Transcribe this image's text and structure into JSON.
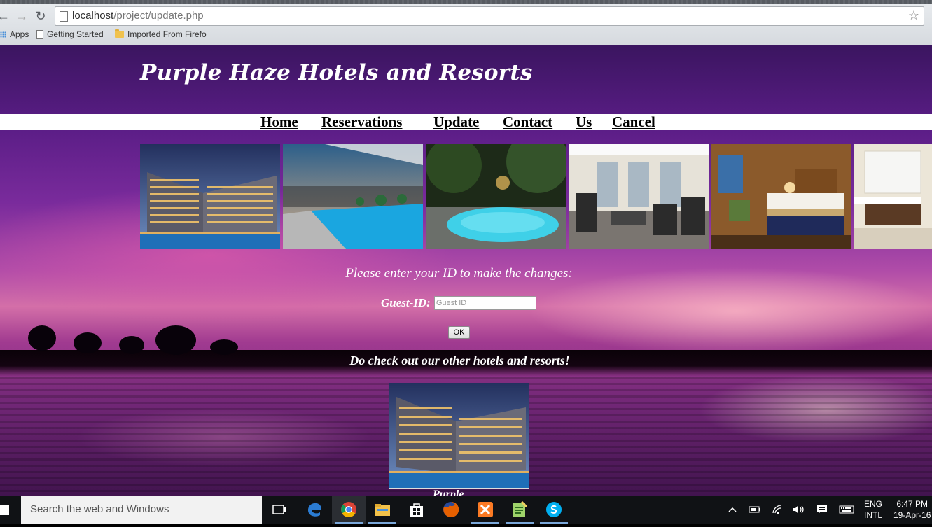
{
  "browser": {
    "url_host": "localhost",
    "url_path": "/project/update.php",
    "bookmarks": [
      {
        "label": "Apps",
        "icon": "apps-grid-icon"
      },
      {
        "label": "Getting Started",
        "icon": "page-icon"
      },
      {
        "label": "Imported From Firefo",
        "icon": "folder-icon"
      }
    ]
  },
  "site": {
    "title": "Purple Haze Hotels and Resorts",
    "nav": [
      "Home",
      "Reservations",
      "Update",
      "Contact",
      "Us",
      "Cancel"
    ],
    "gallery": [
      "hotel-exterior-photo",
      "rooftop-pool-photo",
      "garden-pool-photo",
      "gym-photo",
      "bedroom-photo",
      "bathroom-photo"
    ]
  },
  "form": {
    "prompt": "Please enter your ID to make the changes:",
    "guest_label": "Guest-ID:",
    "guest_placeholder": "Guest ID",
    "guest_value": "",
    "ok_label": "OK"
  },
  "promo": {
    "heading": "Do check out our other hotels and resorts!",
    "caption": "Purple"
  },
  "taskbar": {
    "search_placeholder": "Search the web and Windows",
    "apps": [
      "task-view-icon",
      "edge-icon",
      "chrome-icon",
      "file-explorer-icon",
      "store-icon",
      "firefox-icon",
      "xampp-icon",
      "notepad-icon",
      "skype-icon"
    ],
    "lang_line1": "ENG",
    "lang_line2": "INTL",
    "time": "6:47 PM",
    "date": "19-Apr-16"
  }
}
